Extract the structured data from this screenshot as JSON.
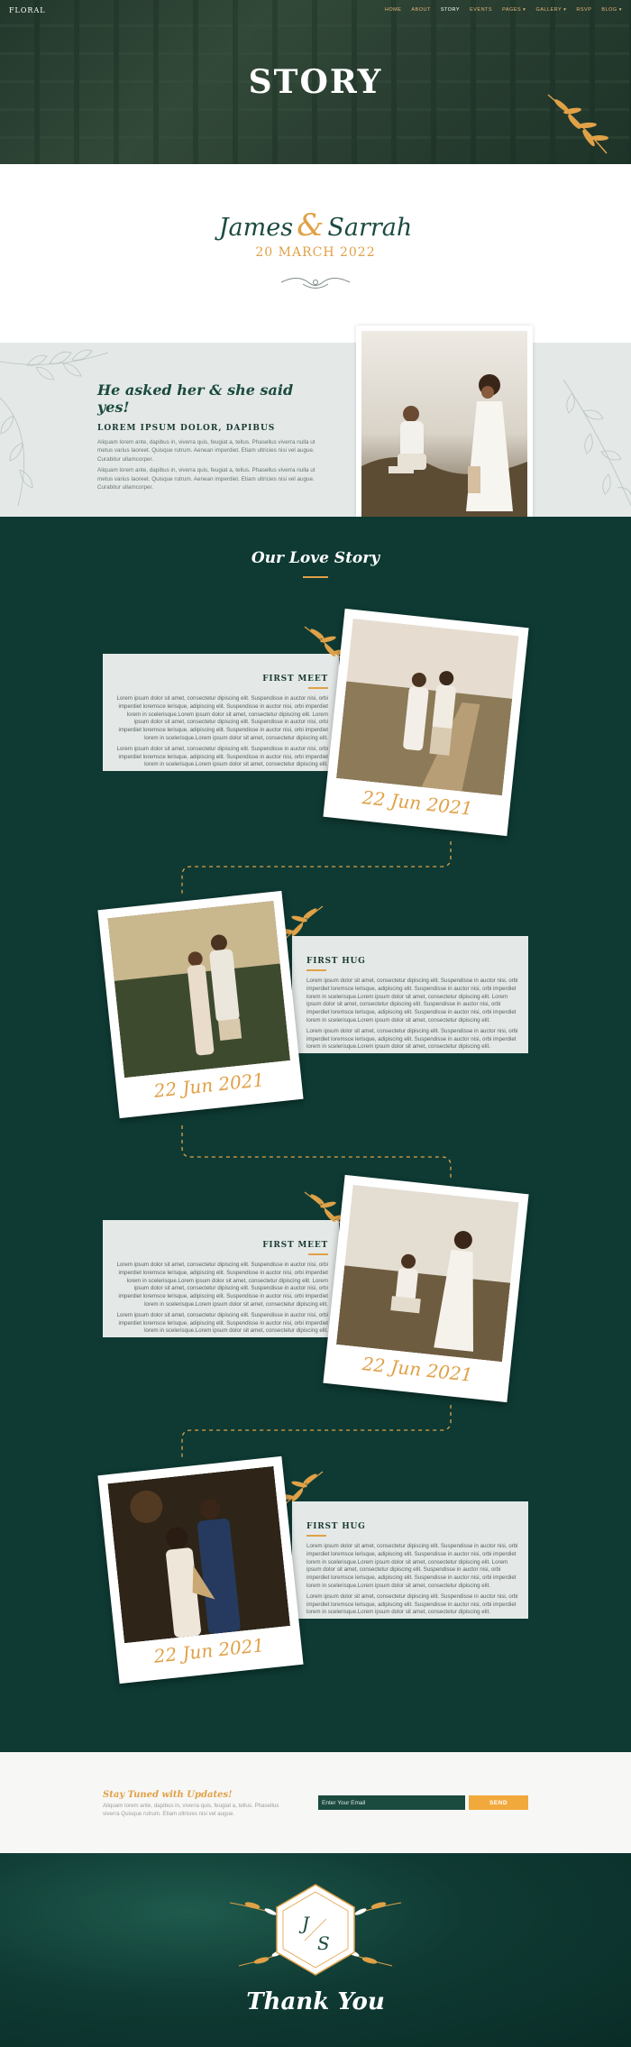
{
  "nav": {
    "logo": "FLORAL",
    "items": [
      {
        "label": "HOME",
        "active": false
      },
      {
        "label": "ABOUT",
        "active": false
      },
      {
        "label": "STORY",
        "active": true
      },
      {
        "label": "EVENTS",
        "active": false
      },
      {
        "label": "PAGES",
        "active": false,
        "dropdown": true
      },
      {
        "label": "GALLERY",
        "active": false,
        "dropdown": true
      },
      {
        "label": "RSVP",
        "active": false
      },
      {
        "label": "BLOG",
        "active": false,
        "dropdown": true
      }
    ]
  },
  "hero": {
    "title": "STORY"
  },
  "couple": {
    "name1": "James",
    "amp": "&",
    "name2": "Sarrah",
    "date": "20 MARCH 2022"
  },
  "proposal": {
    "heading": "He asked her & she said yes!",
    "subheading": "LOREM IPSUM DOLOR, DAPIBUS",
    "para1": "Aliquam lorem ante, dapibus in, viverra quis, feugiat a, tellus. Phasellus viverra nulla ut metus varius laoreet. Quisque rutrum. Aenean imperdiet. Etiam ultricies nisi vel augue. Curabitur ullamcorper.",
    "para2": "Aliquam lorem ante, dapibus in, viverra quis, feugiat a, tellus. Phasellus viverra nulla ut metus varius laoreet. Quisque rutrum. Aenean imperdiet. Etiam ultricies nisi vel augue. Curabitur ullamcorper."
  },
  "love_story": {
    "title": "Our Love Story",
    "events": [
      {
        "title": "FIRST MEET",
        "date": "22 Jun 2021",
        "para1": "Lorem ipsum dolor sit amet, consectetur dipiscing elit. Suspendisse in auctor nisi, orbi imperdiet loremsce lerisque, adipiscing elit. Suspendisse in auctor nisi, orbi imperdiet lorem in scelerisque.Lorem ipsum dolor sit amet, consectetur dipiscing elit. Lorem ipsum dolor sit amet, consectetur dipiscing elit. Suspendisse in auctor nisi, orbi imperdiet loremsce lerisque, adipiscing elit. Suspendisse in auctor nisi, orbi imperdiet lorem in scelerisque.Lorem ipsum dolor sit amet, consectetur dipiscing elit.",
        "para2": "Lorem ipsum dolor sit amet, consectetur dipiscing elit. Suspendisse in auctor nisi, orbi imperdiet loremsce lerisque, adipiscing elit. Suspendisse in auctor nisi, orbi imperdiet lorem in scelerisque.Lorem ipsum dolor sit amet, consectetur dipiscing elit."
      },
      {
        "title": "FIRST HUG",
        "date": "22 Jun 2021",
        "para1": "Lorem ipsum dolor sit amet, consectetur dipiscing elit. Suspendisse in auctor nisi, orbi imperdiet loremsce lerisque, adipiscing elit. Suspendisse in auctor nisi, orbi imperdiet lorem in scelerisque.Lorem ipsum dolor sit amet, consectetur dipiscing elit. Lorem ipsum dolor sit amet, consectetur dipiscing elit. Suspendisse in auctor nisi, orbi imperdiet loremsce lerisque, adipiscing elit. Suspendisse in auctor nisi, orbi imperdiet lorem in scelerisque.Lorem ipsum dolor sit amet, consectetur dipiscing elit.",
        "para2": "Lorem ipsum dolor sit amet, consectetur dipiscing elit. Suspendisse in auctor nisi, orbi imperdiet loremsce lerisque, adipiscing elit. Suspendisse in auctor nisi, orbi imperdiet lorem in scelerisque.Lorem ipsum dolor sit amet, consectetur dipiscing elit."
      },
      {
        "title": "FIRST MEET",
        "date": "22 Jun 2021",
        "para1": "Lorem ipsum dolor sit amet, consectetur dipiscing elit. Suspendisse in auctor nisi, orbi imperdiet loremsce lerisque, adipiscing elit. Suspendisse in auctor nisi, orbi imperdiet lorem in scelerisque.Lorem ipsum dolor sit amet, consectetur dipiscing elit. Lorem ipsum dolor sit amet, consectetur dipiscing elit. Suspendisse in auctor nisi, orbi imperdiet loremsce lerisque, adipiscing elit. Suspendisse in auctor nisi, orbi imperdiet lorem in scelerisque.Lorem ipsum dolor sit amet, consectetur dipiscing elit.",
        "para2": "Lorem ipsum dolor sit amet, consectetur dipiscing elit. Suspendisse in auctor nisi, orbi imperdiet loremsce lerisque, adipiscing elit. Suspendisse in auctor nisi, orbi imperdiet lorem in scelerisque.Lorem ipsum dolor sit amet, consectetur dipiscing elit."
      },
      {
        "title": "FIRST HUG",
        "date": "22 Jun 2021",
        "para1": "Lorem ipsum dolor sit amet, consectetur dipiscing elit. Suspendisse in auctor nisi, orbi imperdiet loremsce lerisque, adipiscing elit. Suspendisse in auctor nisi, orbi imperdiet lorem in scelerisque.Lorem ipsum dolor sit amet, consectetur dipiscing elit. Lorem ipsum dolor sit amet, consectetur dipiscing elit. Suspendisse in auctor nisi, orbi imperdiet loremsce lerisque, adipiscing elit. Suspendisse in auctor nisi, orbi imperdiet lorem in scelerisque.Lorem ipsum dolor sit amet, consectetur dipiscing elit.",
        "para2": "Lorem ipsum dolor sit amet, consectetur dipiscing elit. Suspendisse in auctor nisi, orbi imperdiet loremsce lerisque, adipiscing elit. Suspendisse in auctor nisi, orbi imperdiet lorem in scelerisque.Lorem ipsum dolor sit amet, consectetur dipiscing elit."
      }
    ]
  },
  "subscribe": {
    "title": "Stay Tuned with Updates!",
    "text": "Aliquam lorem ante, dapibus in, viverra quis, feugiat a, tellus. Phasellus viverra Quisque rutrum. Etiam ultricies nisi vel augue.",
    "placeholder": "Enter Your Email",
    "button": "SEND"
  },
  "footer": {
    "monogram": "J S",
    "initial1": "J",
    "initial2": "S",
    "thanks": "Thank You"
  },
  "colors": {
    "primary": "#0e3a33",
    "accent": "#e0a147",
    "light": "#e4e9e7"
  }
}
